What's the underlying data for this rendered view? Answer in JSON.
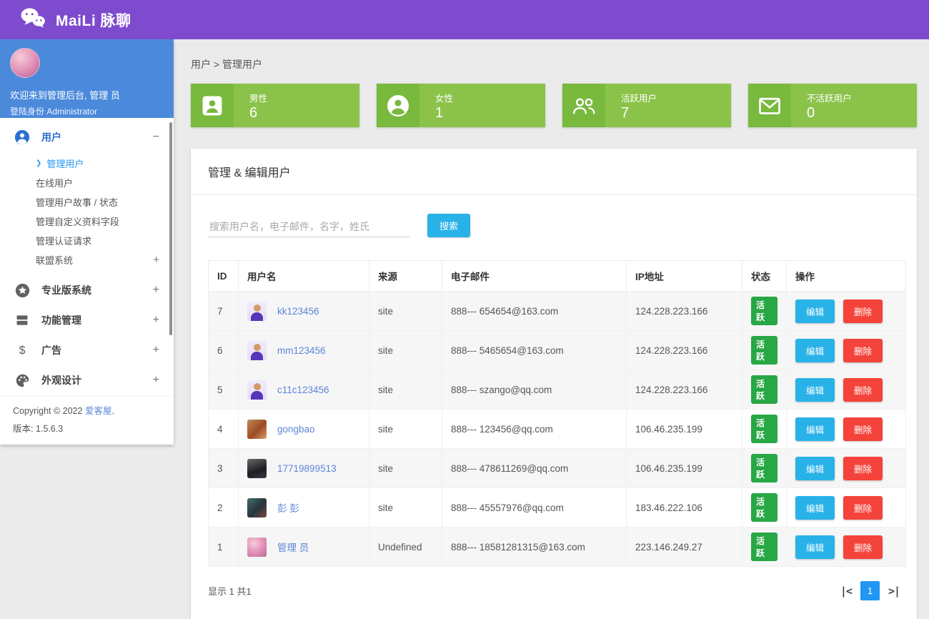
{
  "app": {
    "title": "MaiLi 脉聊"
  },
  "colors": {
    "header_purple": "#7e4bce",
    "profile_blue": "#4b8adb",
    "card_green": "#8bc34a",
    "card_green_dark": "#79b93e",
    "primary_blue": "#29b2e8",
    "danger_red": "#f4433a",
    "badge_green": "#28a745",
    "active_page_blue": "#2196f3"
  },
  "sidebar": {
    "welcome_line1": "欢迎来到管理后台, 管理 员",
    "welcome_line2": "登陆身份 Administrator",
    "menu": [
      {
        "label": "用户",
        "icon": "user-icon",
        "toggle": "−",
        "children": [
          {
            "label": "管理用户",
            "arrow": "❯"
          },
          {
            "label": "在线用户"
          },
          {
            "label": "管理用户故事 / 状态"
          },
          {
            "label": "管理自定义资料字段"
          },
          {
            "label": "管理认证请求"
          },
          {
            "label": "联盟系统",
            "toggle": "+"
          }
        ]
      },
      {
        "label": "专业版系统",
        "icon": "star-circle-icon",
        "toggle": "+"
      },
      {
        "label": "功能管理",
        "icon": "bars-icon",
        "toggle": "+"
      },
      {
        "label": "广告",
        "icon": "dollar-icon",
        "toggle": "+"
      },
      {
        "label": "外观设计",
        "icon": "palette-icon",
        "toggle": "+"
      }
    ],
    "copyright_prefix": "Copyright © 2022 ",
    "copyright_link": "爱客屋",
    "copyright_suffix": ".",
    "version": "版本: 1.5.6.3"
  },
  "breadcrumb": "用户 > 管理用户",
  "stats": [
    {
      "label": "男性",
      "value": "6",
      "icon": "male-user-card-icon"
    },
    {
      "label": "女性",
      "value": "1",
      "icon": "female-user-circle-icon"
    },
    {
      "label": "活跃用户",
      "value": "7",
      "icon": "users-group-icon"
    },
    {
      "label": "不活跃用户",
      "value": "0",
      "icon": "envelope-icon"
    }
  ],
  "panel": {
    "title": "管理 & 编辑用户",
    "search": {
      "placeholder": "搜索用户名，电子邮件，名字，姓氏",
      "button": "搜索"
    },
    "table": {
      "headers": [
        "ID",
        "用户名",
        "来源",
        "电子邮件",
        "IP地址",
        "状态",
        "操作"
      ],
      "edit_label": "编辑",
      "delete_label": "删除",
      "rows": [
        {
          "id": "7",
          "username": "kk123456",
          "source": "site",
          "email": "888--- 654654@163.com",
          "ip": "124.228.223.166",
          "status": "活跃"
        },
        {
          "id": "6",
          "username": "mm123456",
          "source": "site",
          "email": "888--- 5465654@163.com",
          "ip": "124.228.223.166",
          "status": "活跃"
        },
        {
          "id": "5",
          "username": "c11c123456",
          "source": "site",
          "email": "888--- szango@qq.com",
          "ip": "124.228.223.166",
          "status": "活跃"
        },
        {
          "id": "4",
          "username": "gongbao",
          "source": "site",
          "email": "888--- 123456@qq.com",
          "ip": "106.46.235.199",
          "status": "活跃"
        },
        {
          "id": "3",
          "username": "17719899513",
          "source": "site",
          "email": "888--- 478611269@qq.com",
          "ip": "106.46.235.199",
          "status": "活跃"
        },
        {
          "id": "2",
          "username": "彭 彭",
          "source": "site",
          "email": "888--- 45557976@qq.com",
          "ip": "183.46.222.106",
          "status": "活跃"
        },
        {
          "id": "1",
          "username": "管理 员",
          "source": "Undefined",
          "email": "888--- 18581281315@163.com",
          "ip": "223.146.249.27",
          "status": "活跃"
        }
      ]
    },
    "footer": {
      "summary": "显示 1 共1",
      "first_icon": "|<",
      "page": "1",
      "last_icon": ">|"
    }
  }
}
